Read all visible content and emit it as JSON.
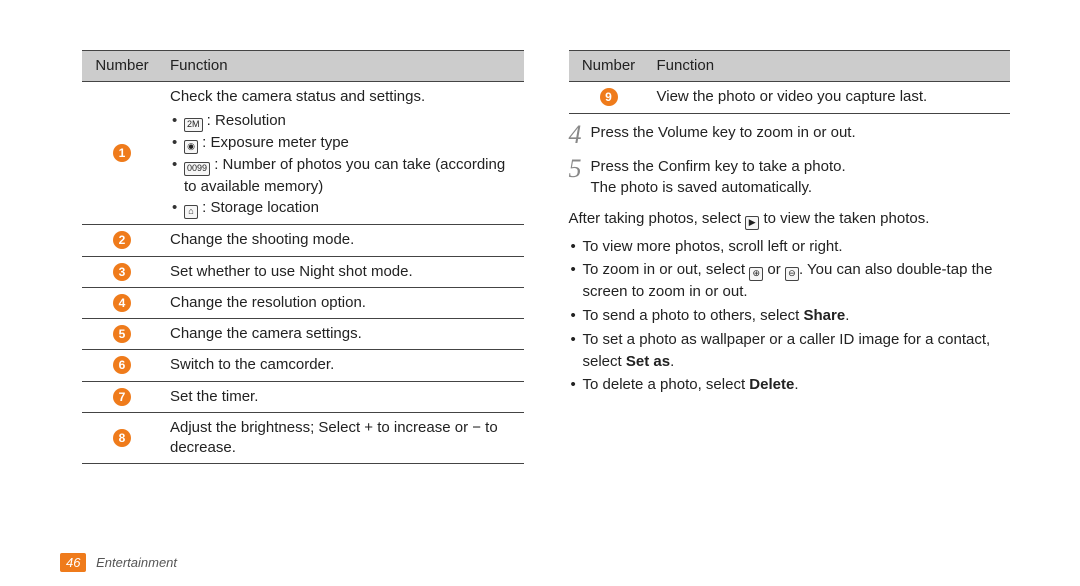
{
  "tableHeader": {
    "number": "Number",
    "function": "Function"
  },
  "leftTable": {
    "rows": [
      {
        "n": "1",
        "lead": "Check the camera status and settings.",
        "subs": [
          {
            "iconTxt": "2M",
            "iconName": "resolution-2m-icon",
            "txt": ": Resolution"
          },
          {
            "iconTxt": "◉",
            "iconName": "exposure-meter-icon",
            "txt": ": Exposure meter type"
          },
          {
            "iconTxt": "0099",
            "iconName": "remaining-shots-counter-icon",
            "txt": ": Number of photos you can take (according to available memory)"
          },
          {
            "iconTxt": "⌂",
            "iconName": "storage-location-icon",
            "txt": ": Storage location"
          }
        ]
      },
      {
        "n": "2",
        "txt": "Change the shooting mode."
      },
      {
        "n": "3",
        "txt": "Set whether to use Night shot mode."
      },
      {
        "n": "4",
        "txt": "Change the resolution option."
      },
      {
        "n": "5",
        "txt": "Change the camera settings."
      },
      {
        "n": "6",
        "txt": "Switch to the camcorder."
      },
      {
        "n": "7",
        "txt": "Set the timer."
      },
      {
        "n": "8",
        "txt": "Adjust the brightness; Select + to increase or − to decrease."
      }
    ]
  },
  "rightTable": {
    "rows": [
      {
        "n": "9",
        "txt": "View the photo or video you capture last."
      }
    ]
  },
  "steps": [
    {
      "n": "4",
      "txt": "Press the Volume key to zoom in or out."
    },
    {
      "n": "5",
      "txt": "Press the Confirm key to take a photo.",
      "txt2": "The photo is saved automatically."
    }
  ],
  "after": {
    "leadA": "After taking photos, select ",
    "playIcon": "▶",
    "leadB": " to view the taken photos."
  },
  "tips": [
    {
      "txt": "To view more photos, scroll left or right."
    },
    {
      "pre": "To zoom in or out, select ",
      "iconA": "⊕",
      "mid": " or ",
      "iconB": "⊖",
      "post": ". You can also double-tap the screen to zoom in or out."
    },
    {
      "pre": "To send a photo to others, select ",
      "bold": "Share",
      "post": "."
    },
    {
      "pre": "To set a photo as wallpaper or a caller ID image for a contact, select ",
      "bold": "Set as",
      "post": "."
    },
    {
      "pre": "To delete a photo, select ",
      "bold": "Delete",
      "post": "."
    }
  ],
  "footer": {
    "page": "46",
    "section": "Entertainment"
  }
}
